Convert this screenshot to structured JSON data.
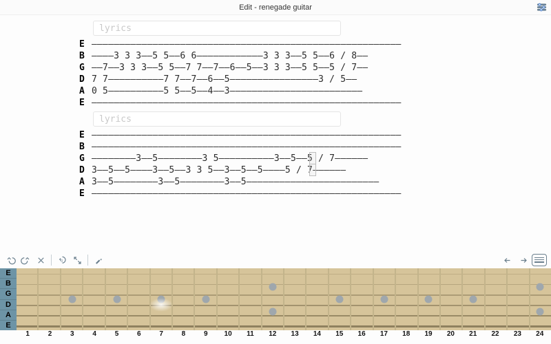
{
  "header": {
    "title": "Edit - renegade guitar"
  },
  "lyrics_placeholder": "lyrics",
  "sections": [
    {
      "lyrics": "",
      "rows": [
        {
          "tuning": "E",
          "tab": "————————————————————————————————————————————————————————"
        },
        {
          "tuning": "B",
          "tab": "————3 3 3——5 5——6 6————————————3 3 3——5 5——6 / 8——"
        },
        {
          "tuning": "G",
          "tab": "——7——3 3 3——5 5——7 7——7——6——5——3 3 3——5 5——5 / 7——"
        },
        {
          "tuning": "D",
          "tab": "7 7——————————7 7——7——6——5————————————————3 / 5——"
        },
        {
          "tuning": "A",
          "tab": "0 5——————————5 5——5——4——3————————————————————————"
        },
        {
          "tuning": "E",
          "tab": "————————————————————————————————————————————————————————"
        }
      ]
    },
    {
      "lyrics": "",
      "rows": [
        {
          "tuning": "E",
          "tab": "————————————————————————————————————————————————————————"
        },
        {
          "tuning": "B",
          "tab": "————————————————————————————————————————————————————————"
        },
        {
          "tuning": "G",
          "tab": "————————3——5————————3 5——————————3——5——5 / 7——————"
        },
        {
          "tuning": "D",
          "tab": "3——5——5————3——5——3 3 5——3——5——5————5 / 7——————"
        },
        {
          "tuning": "A",
          "tab": "3——5————————3——5————————3——5————————————————————————"
        },
        {
          "tuning": "E",
          "tab": "————————————————————————————————————————————————————————"
        }
      ]
    }
  ],
  "cursor": {
    "section": 1,
    "string_from": 2,
    "string_to": 3,
    "char": 40,
    "width_chars": 1
  },
  "toolbar": {
    "items": [
      "undo",
      "redo",
      "delete",
      "|",
      "capo",
      "expand",
      "|",
      "wrench"
    ],
    "right_items": [
      "nav-left",
      "nav-right",
      "keyboard"
    ]
  },
  "fretboard": {
    "tuning_open": [
      "E",
      "B",
      "G",
      "D",
      "A",
      "E"
    ],
    "fret_count": 24,
    "single_dots": [
      3,
      5,
      7,
      9,
      15,
      17,
      19,
      21
    ],
    "double_dots": [
      12,
      24
    ],
    "highlight_fret": 7,
    "highlight_string": 3
  }
}
